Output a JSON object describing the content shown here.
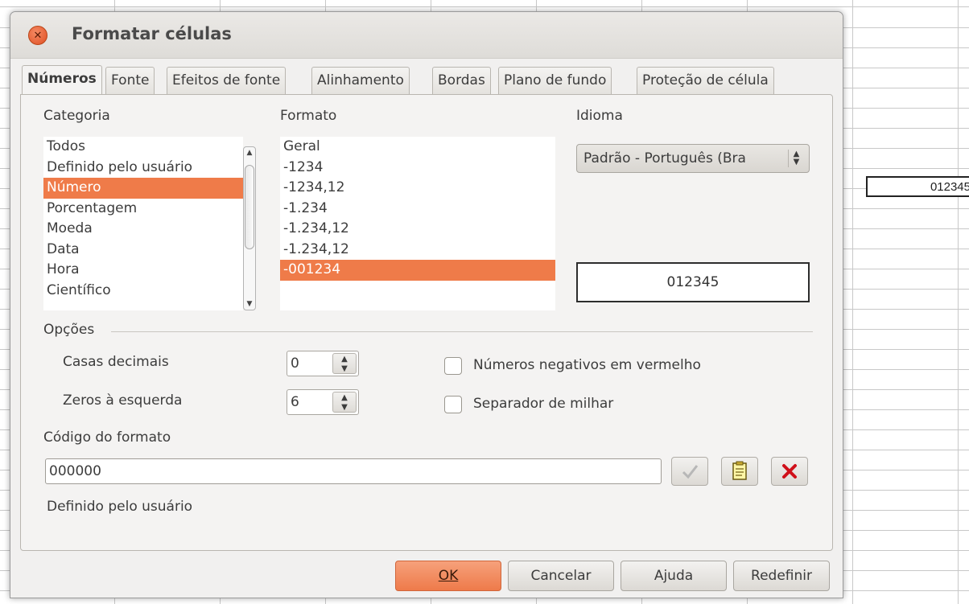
{
  "spreadsheet": {
    "cell_value": "012345"
  },
  "dialog": {
    "title": "Formatar células",
    "close_icon": "close-icon",
    "tabs": [
      {
        "label": "Números",
        "active": true
      },
      {
        "label": "Fonte",
        "active": false
      },
      {
        "label": "Efeitos de fonte",
        "active": false
      },
      {
        "label": "Alinhamento",
        "active": false
      },
      {
        "label": "Bordas",
        "active": false
      },
      {
        "label": "Plano de fundo",
        "active": false
      },
      {
        "label": "Proteção de célula",
        "active": false
      }
    ],
    "category": {
      "label": "Categoria",
      "items": [
        "Todos",
        "Definido pelo usuário",
        "Número",
        "Porcentagem",
        "Moeda",
        "Data",
        "Hora",
        "Científico"
      ],
      "selected": "Número"
    },
    "format": {
      "label": "Formato",
      "items": [
        "Geral",
        "-1234",
        "-1234,12",
        "-1.234",
        "-1.234,12",
        "-1.234,12",
        "-001234"
      ],
      "selected": "-001234"
    },
    "language": {
      "label": "Idioma",
      "value": "Padrão - Português (Bra"
    },
    "preview": {
      "value": "012345"
    },
    "options": {
      "label": "Opções",
      "decimals_label": "Casas decimais",
      "decimals_value": "0",
      "leading_zeros_label": "Zeros à esquerda",
      "leading_zeros_value": "6",
      "negative_red_label": "Números negativos em vermelho",
      "negative_red_checked": false,
      "thousands_sep_label": "Separador de milhar",
      "thousands_sep_checked": false
    },
    "format_code": {
      "label": "Código do formato",
      "value": "000000",
      "description": "Definido pelo usuário"
    },
    "code_buttons": [
      "check-icon",
      "comment-icon",
      "delete-icon"
    ],
    "buttons": {
      "ok": "OK",
      "cancel": "Cancelar",
      "help": "Ajuda",
      "reset": "Redefinir"
    },
    "accent_color": "#ef7b49"
  }
}
